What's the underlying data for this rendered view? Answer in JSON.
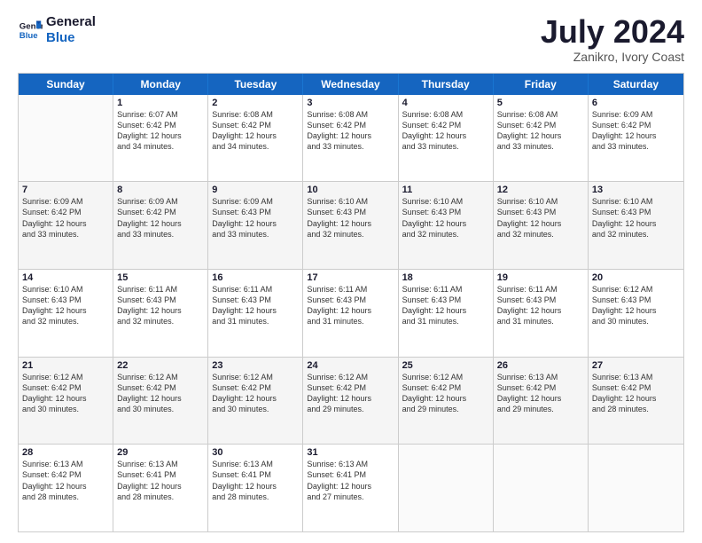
{
  "logo": {
    "line1": "General",
    "line2": "Blue"
  },
  "title": "July 2024",
  "location": "Zanikro, Ivory Coast",
  "days_header": [
    "Sunday",
    "Monday",
    "Tuesday",
    "Wednesday",
    "Thursday",
    "Friday",
    "Saturday"
  ],
  "weeks": [
    [
      {
        "day": "",
        "sunrise": "",
        "sunset": "",
        "daylight": ""
      },
      {
        "day": "1",
        "sunrise": "Sunrise: 6:07 AM",
        "sunset": "Sunset: 6:42 PM",
        "daylight": "Daylight: 12 hours",
        "daylight2": "and 34 minutes."
      },
      {
        "day": "2",
        "sunrise": "Sunrise: 6:08 AM",
        "sunset": "Sunset: 6:42 PM",
        "daylight": "Daylight: 12 hours",
        "daylight2": "and 34 minutes."
      },
      {
        "day": "3",
        "sunrise": "Sunrise: 6:08 AM",
        "sunset": "Sunset: 6:42 PM",
        "daylight": "Daylight: 12 hours",
        "daylight2": "and 33 minutes."
      },
      {
        "day": "4",
        "sunrise": "Sunrise: 6:08 AM",
        "sunset": "Sunset: 6:42 PM",
        "daylight": "Daylight: 12 hours",
        "daylight2": "and 33 minutes."
      },
      {
        "day": "5",
        "sunrise": "Sunrise: 6:08 AM",
        "sunset": "Sunset: 6:42 PM",
        "daylight": "Daylight: 12 hours",
        "daylight2": "and 33 minutes."
      },
      {
        "day": "6",
        "sunrise": "Sunrise: 6:09 AM",
        "sunset": "Sunset: 6:42 PM",
        "daylight": "Daylight: 12 hours",
        "daylight2": "and 33 minutes."
      }
    ],
    [
      {
        "day": "7",
        "sunrise": "Sunrise: 6:09 AM",
        "sunset": "Sunset: 6:42 PM",
        "daylight": "Daylight: 12 hours",
        "daylight2": "and 33 minutes."
      },
      {
        "day": "8",
        "sunrise": "Sunrise: 6:09 AM",
        "sunset": "Sunset: 6:42 PM",
        "daylight": "Daylight: 12 hours",
        "daylight2": "and 33 minutes."
      },
      {
        "day": "9",
        "sunrise": "Sunrise: 6:09 AM",
        "sunset": "Sunset: 6:43 PM",
        "daylight": "Daylight: 12 hours",
        "daylight2": "and 33 minutes."
      },
      {
        "day": "10",
        "sunrise": "Sunrise: 6:10 AM",
        "sunset": "Sunset: 6:43 PM",
        "daylight": "Daylight: 12 hours",
        "daylight2": "and 32 minutes."
      },
      {
        "day": "11",
        "sunrise": "Sunrise: 6:10 AM",
        "sunset": "Sunset: 6:43 PM",
        "daylight": "Daylight: 12 hours",
        "daylight2": "and 32 minutes."
      },
      {
        "day": "12",
        "sunrise": "Sunrise: 6:10 AM",
        "sunset": "Sunset: 6:43 PM",
        "daylight": "Daylight: 12 hours",
        "daylight2": "and 32 minutes."
      },
      {
        "day": "13",
        "sunrise": "Sunrise: 6:10 AM",
        "sunset": "Sunset: 6:43 PM",
        "daylight": "Daylight: 12 hours",
        "daylight2": "and 32 minutes."
      }
    ],
    [
      {
        "day": "14",
        "sunrise": "Sunrise: 6:10 AM",
        "sunset": "Sunset: 6:43 PM",
        "daylight": "Daylight: 12 hours",
        "daylight2": "and 32 minutes."
      },
      {
        "day": "15",
        "sunrise": "Sunrise: 6:11 AM",
        "sunset": "Sunset: 6:43 PM",
        "daylight": "Daylight: 12 hours",
        "daylight2": "and 32 minutes."
      },
      {
        "day": "16",
        "sunrise": "Sunrise: 6:11 AM",
        "sunset": "Sunset: 6:43 PM",
        "daylight": "Daylight: 12 hours",
        "daylight2": "and 31 minutes."
      },
      {
        "day": "17",
        "sunrise": "Sunrise: 6:11 AM",
        "sunset": "Sunset: 6:43 PM",
        "daylight": "Daylight: 12 hours",
        "daylight2": "and 31 minutes."
      },
      {
        "day": "18",
        "sunrise": "Sunrise: 6:11 AM",
        "sunset": "Sunset: 6:43 PM",
        "daylight": "Daylight: 12 hours",
        "daylight2": "and 31 minutes."
      },
      {
        "day": "19",
        "sunrise": "Sunrise: 6:11 AM",
        "sunset": "Sunset: 6:43 PM",
        "daylight": "Daylight: 12 hours",
        "daylight2": "and 31 minutes."
      },
      {
        "day": "20",
        "sunrise": "Sunrise: 6:12 AM",
        "sunset": "Sunset: 6:43 PM",
        "daylight": "Daylight: 12 hours",
        "daylight2": "and 30 minutes."
      }
    ],
    [
      {
        "day": "21",
        "sunrise": "Sunrise: 6:12 AM",
        "sunset": "Sunset: 6:42 PM",
        "daylight": "Daylight: 12 hours",
        "daylight2": "and 30 minutes."
      },
      {
        "day": "22",
        "sunrise": "Sunrise: 6:12 AM",
        "sunset": "Sunset: 6:42 PM",
        "daylight": "Daylight: 12 hours",
        "daylight2": "and 30 minutes."
      },
      {
        "day": "23",
        "sunrise": "Sunrise: 6:12 AM",
        "sunset": "Sunset: 6:42 PM",
        "daylight": "Daylight: 12 hours",
        "daylight2": "and 30 minutes."
      },
      {
        "day": "24",
        "sunrise": "Sunrise: 6:12 AM",
        "sunset": "Sunset: 6:42 PM",
        "daylight": "Daylight: 12 hours",
        "daylight2": "and 29 minutes."
      },
      {
        "day": "25",
        "sunrise": "Sunrise: 6:12 AM",
        "sunset": "Sunset: 6:42 PM",
        "daylight": "Daylight: 12 hours",
        "daylight2": "and 29 minutes."
      },
      {
        "day": "26",
        "sunrise": "Sunrise: 6:13 AM",
        "sunset": "Sunset: 6:42 PM",
        "daylight": "Daylight: 12 hours",
        "daylight2": "and 29 minutes."
      },
      {
        "day": "27",
        "sunrise": "Sunrise: 6:13 AM",
        "sunset": "Sunset: 6:42 PM",
        "daylight": "Daylight: 12 hours",
        "daylight2": "and 28 minutes."
      }
    ],
    [
      {
        "day": "28",
        "sunrise": "Sunrise: 6:13 AM",
        "sunset": "Sunset: 6:42 PM",
        "daylight": "Daylight: 12 hours",
        "daylight2": "and 28 minutes."
      },
      {
        "day": "29",
        "sunrise": "Sunrise: 6:13 AM",
        "sunset": "Sunset: 6:41 PM",
        "daylight": "Daylight: 12 hours",
        "daylight2": "and 28 minutes."
      },
      {
        "day": "30",
        "sunrise": "Sunrise: 6:13 AM",
        "sunset": "Sunset: 6:41 PM",
        "daylight": "Daylight: 12 hours",
        "daylight2": "and 28 minutes."
      },
      {
        "day": "31",
        "sunrise": "Sunrise: 6:13 AM",
        "sunset": "Sunset: 6:41 PM",
        "daylight": "Daylight: 12 hours",
        "daylight2": "and 27 minutes."
      },
      {
        "day": "",
        "sunrise": "",
        "sunset": "",
        "daylight": "",
        "daylight2": ""
      },
      {
        "day": "",
        "sunrise": "",
        "sunset": "",
        "daylight": "",
        "daylight2": ""
      },
      {
        "day": "",
        "sunrise": "",
        "sunset": "",
        "daylight": "",
        "daylight2": ""
      }
    ]
  ]
}
